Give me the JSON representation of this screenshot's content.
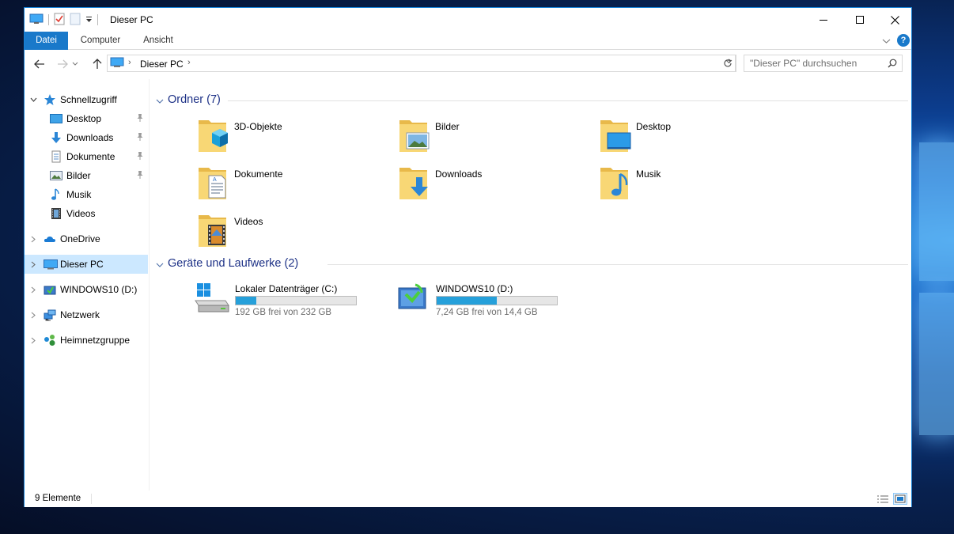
{
  "window": {
    "title": "Dieser PC"
  },
  "ribbon": {
    "tabs": [
      "Datei",
      "Computer",
      "Ansicht"
    ]
  },
  "address": {
    "crumb": "Dieser PC"
  },
  "search": {
    "placeholder": "\"Dieser PC\" durchsuchen"
  },
  "navpane": {
    "quick_access": "Schnellzugriff",
    "quick_items": [
      {
        "label": "Desktop",
        "icon": "desktop-icon"
      },
      {
        "label": "Downloads",
        "icon": "downloads-icon"
      },
      {
        "label": "Dokumente",
        "icon": "documents-icon"
      },
      {
        "label": "Bilder",
        "icon": "pictures-icon"
      },
      {
        "label": "Musik",
        "icon": "music-icon"
      },
      {
        "label": "Videos",
        "icon": "videos-icon"
      }
    ],
    "onedrive": "OneDrive",
    "this_pc": "Dieser PC",
    "drive_d": "WINDOWS10 (D:)",
    "network": "Netzwerk",
    "homegroup": "Heimnetzgruppe"
  },
  "groups": {
    "folders_title": "Ordner (7)",
    "devices_title": "Geräte und Laufwerke (2)"
  },
  "folders": [
    {
      "name": "3D-Objekte",
      "icon": "3d-objects-folder-icon"
    },
    {
      "name": "Bilder",
      "icon": "pictures-folder-icon"
    },
    {
      "name": "Desktop",
      "icon": "desktop-folder-icon"
    },
    {
      "name": "Dokumente",
      "icon": "documents-folder-icon"
    },
    {
      "name": "Downloads",
      "icon": "downloads-folder-icon"
    },
    {
      "name": "Musik",
      "icon": "music-folder-icon"
    },
    {
      "name": "Videos",
      "icon": "videos-folder-icon"
    }
  ],
  "drives": [
    {
      "name": "Lokaler Datenträger (C:)",
      "free_text": "192 GB frei von 232 GB",
      "used_fraction": 0.17,
      "icon": "system-drive-icon"
    },
    {
      "name": "WINDOWS10 (D:)",
      "free_text": "7,24 GB frei von 14,4 GB",
      "used_fraction": 0.5,
      "icon": "usb-setup-drive-icon"
    }
  ],
  "status": {
    "count": "9 Elemente"
  },
  "colors": {
    "accent": "#1979ca",
    "group_title": "#1e3287",
    "selection": "#cce8ff",
    "drive_bar": "#26a0da",
    "folder_yellow": "#f8d775"
  }
}
